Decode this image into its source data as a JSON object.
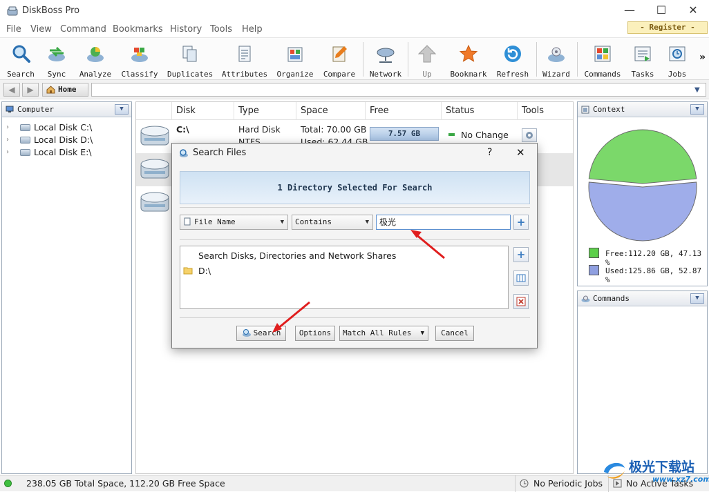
{
  "app": {
    "title": "DiskBoss Pro"
  },
  "window_controls": {
    "minimize": "—",
    "maximize": "☐",
    "close": "✕"
  },
  "menu": [
    "File",
    "View",
    "Command",
    "Bookmarks",
    "History",
    "Tools",
    "Help"
  ],
  "register_label": "- Register -",
  "toolbar": [
    {
      "label": "Search",
      "icon": "search-icon"
    },
    {
      "label": "Sync",
      "icon": "sync-icon"
    },
    {
      "label": "Analyze",
      "icon": "analyze-icon"
    },
    {
      "label": "Classify",
      "icon": "classify-icon"
    },
    {
      "label": "Duplicates",
      "icon": "duplicates-icon"
    },
    {
      "label": "Attributes",
      "icon": "attributes-icon"
    },
    {
      "label": "Organize",
      "icon": "organize-icon"
    },
    {
      "label": "Compare",
      "icon": "compare-icon"
    },
    {
      "label": "Network",
      "icon": "network-icon"
    },
    {
      "label": "Up",
      "icon": "up-arrow-icon"
    },
    {
      "label": "Bookmark",
      "icon": "star-icon"
    },
    {
      "label": "Refresh",
      "icon": "refresh-icon"
    },
    {
      "label": "Wizard",
      "icon": "wizard-icon"
    },
    {
      "label": "Commands",
      "icon": "commands-icon"
    },
    {
      "label": "Tasks",
      "icon": "tasks-icon"
    },
    {
      "label": "Jobs",
      "icon": "jobs-icon"
    }
  ],
  "toolbar_overflow": "»",
  "navbar": {
    "home_label": "Home",
    "path_value": ""
  },
  "computer_panel": {
    "title": "Computer",
    "items": [
      "Local Disk C:\\",
      "Local Disk D:\\",
      "Local Disk E:\\"
    ]
  },
  "disk_table": {
    "columns": [
      "Disk",
      "Type",
      "Space",
      "Free",
      "Status",
      "Tools"
    ],
    "rows": [
      {
        "disk": "C:\\",
        "type": "Hard Disk",
        "type2": "NTFS",
        "space": "Total: 70.00 GB",
        "space2": "Used: 62.44 GB",
        "free": "7.57 GB",
        "status": "No Change"
      }
    ]
  },
  "context_panel": {
    "title": "Context",
    "legend": [
      {
        "label": "Free:112.20 GB, 47.13 %",
        "color": "#5ccf4a"
      },
      {
        "label": "Used:125.86 GB, 52.87 %",
        "color": "#8f9fe0"
      }
    ]
  },
  "chart_data": {
    "type": "pie",
    "categories": [
      "Free",
      "Used"
    ],
    "values": [
      47.13,
      52.87
    ],
    "colors": [
      "#7bd86a",
      "#9fadea"
    ]
  },
  "commands_panel": {
    "title": "Commands"
  },
  "dialog": {
    "title": "Search Files",
    "help": "?",
    "close": "✕",
    "banner": "1 Directory Selected For Search",
    "field_combo": "File Name",
    "condition_combo": "Contains",
    "query_value": "极光",
    "dirs_header": "Search Disks, Directories and Network Shares",
    "dirs": [
      "D:\\"
    ],
    "buttons": {
      "search": "Search",
      "options": "Options",
      "match": "Match All Rules",
      "cancel": "Cancel"
    }
  },
  "statusbar": {
    "space": "238.05 GB Total Space, 112.20 GB Free Space",
    "periodic": "No Periodic Jobs",
    "active": "No Active Tasks"
  },
  "watermark": {
    "text": "极光下载站",
    "url": "www.xz7.com"
  }
}
